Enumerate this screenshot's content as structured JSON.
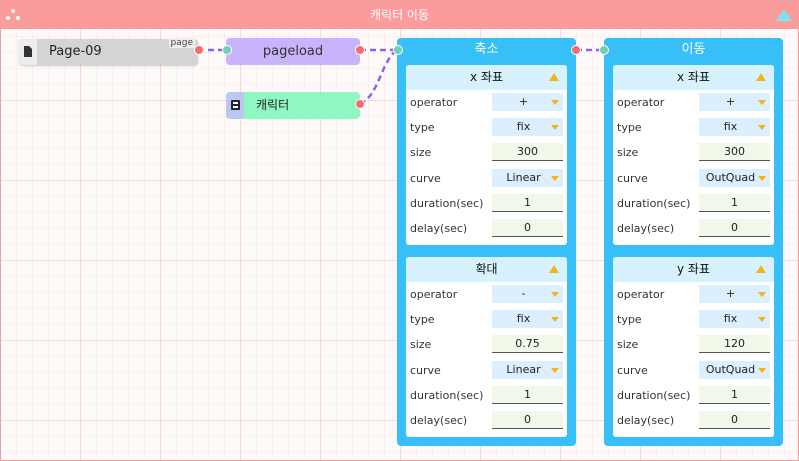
{
  "window": {
    "title": "캐릭터 이동"
  },
  "nodes": {
    "page": {
      "name": "Page-09",
      "port_label": "page"
    },
    "pageload": {
      "label": "pageload"
    },
    "character": {
      "label": "캐릭터"
    }
  },
  "groups": [
    {
      "title": "축소",
      "cards": [
        {
          "title": "x 좌표",
          "rows": [
            {
              "label": "operator",
              "value": "+"
            },
            {
              "label": "type",
              "value": "fix"
            },
            {
              "label": "size",
              "value": "300"
            },
            {
              "label": "curve",
              "value": "Linear"
            },
            {
              "label": "duration(sec)",
              "value": "1"
            },
            {
              "label": "delay(sec)",
              "value": "0"
            }
          ]
        },
        {
          "title": "확대",
          "rows": [
            {
              "label": "operator",
              "value": "-"
            },
            {
              "label": "type",
              "value": "fix"
            },
            {
              "label": "size",
              "value": "0.75"
            },
            {
              "label": "curve",
              "value": "Linear"
            },
            {
              "label": "duration(sec)",
              "value": "1"
            },
            {
              "label": "delay(sec)",
              "value": "0"
            }
          ]
        }
      ]
    },
    {
      "title": "이동",
      "cards": [
        {
          "title": "x 좌표",
          "rows": [
            {
              "label": "operator",
              "value": "+"
            },
            {
              "label": "type",
              "value": "fix"
            },
            {
              "label": "size",
              "value": "300"
            },
            {
              "label": "curve",
              "value": "OutQuad"
            },
            {
              "label": "duration(sec)",
              "value": "1"
            },
            {
              "label": "delay(sec)",
              "value": "0"
            }
          ]
        },
        {
          "title": "y 좌표",
          "rows": [
            {
              "label": "operator",
              "value": "+"
            },
            {
              "label": "type",
              "value": "fix"
            },
            {
              "label": "size",
              "value": "120"
            },
            {
              "label": "curve",
              "value": "OutQuad"
            },
            {
              "label": "duration(sec)",
              "value": "1"
            },
            {
              "label": "delay(sec)",
              "value": "0"
            }
          ]
        }
      ]
    }
  ],
  "colors": {
    "titlebar": "#fb9b9b",
    "group": "#37bff8",
    "pageload": "#c8b4fb",
    "character": "#8ff7c2",
    "wire": "#8a63e6",
    "port_out": "#f36f6f",
    "port_in": "#6fcfb8",
    "dropdown_arrow": "#f2b318"
  }
}
